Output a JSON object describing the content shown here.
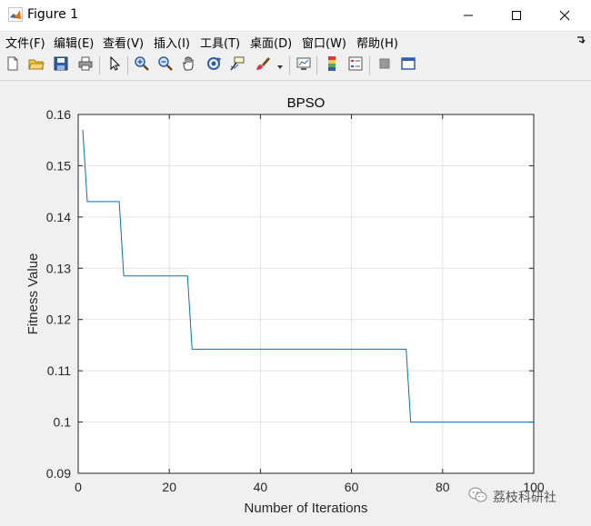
{
  "window": {
    "title": "Figure 1",
    "controls": {
      "minimize": "—",
      "maximize": "☐",
      "close": "✕"
    }
  },
  "menubar": {
    "items": [
      {
        "label": "文件(F)"
      },
      {
        "label": "编辑(E)"
      },
      {
        "label": "查看(V)"
      },
      {
        "label": "插入(I)"
      },
      {
        "label": "工具(T)"
      },
      {
        "label": "桌面(D)"
      },
      {
        "label": "窗口(W)"
      },
      {
        "label": "帮助(H)"
      }
    ]
  },
  "toolbar": {
    "icons": [
      "new-figure",
      "open-file",
      "save",
      "print",
      "edit-plot-pointer",
      "zoom-in",
      "zoom-out",
      "pan",
      "rotate-3d",
      "data-cursor",
      "brush",
      "brush-dropdown",
      "link-plot",
      "insert-colorbar",
      "insert-legend",
      "hide-plot-tools",
      "show-plot-tools"
    ]
  },
  "chart_data": {
    "type": "line",
    "title": "BPSO",
    "xlabel": "Number of Iterations",
    "ylabel": "Fitness Value",
    "xlim": [
      0,
      100
    ],
    "ylim": [
      0.09,
      0.16
    ],
    "xticks": [
      "0",
      "20",
      "40",
      "60",
      "80",
      "100"
    ],
    "yticks": [
      "0.09",
      "0.1",
      "0.11",
      "0.12",
      "0.13",
      "0.14",
      "0.15",
      "0.16"
    ],
    "grid": true,
    "series": [
      {
        "color": "#0072bd",
        "x": [
          1,
          2,
          9,
          10,
          24,
          25,
          72,
          73,
          100
        ],
        "y": [
          0.157,
          0.143,
          0.143,
          0.1285,
          0.1285,
          0.1142,
          0.1142,
          0.1,
          0.1
        ]
      }
    ]
  },
  "watermark": {
    "text": "荔枝科研社"
  }
}
